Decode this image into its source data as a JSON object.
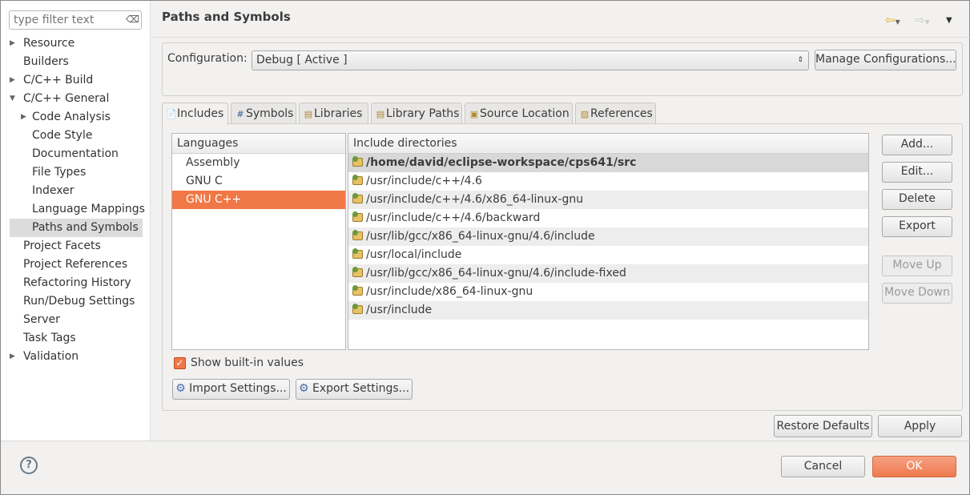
{
  "sidebar": {
    "filter_placeholder": "type filter text",
    "items": [
      {
        "label": "Resource",
        "level": 0,
        "arrow": "collapsed"
      },
      {
        "label": "Builders",
        "level": 0,
        "arrow": "none"
      },
      {
        "label": "C/C++ Build",
        "level": 0,
        "arrow": "collapsed"
      },
      {
        "label": "C/C++ General",
        "level": 0,
        "arrow": "expanded"
      },
      {
        "label": "Code Analysis",
        "level": 1,
        "arrow": "collapsed"
      },
      {
        "label": "Code Style",
        "level": 1,
        "arrow": "none"
      },
      {
        "label": "Documentation",
        "level": 1,
        "arrow": "none"
      },
      {
        "label": "File Types",
        "level": 1,
        "arrow": "none"
      },
      {
        "label": "Indexer",
        "level": 1,
        "arrow": "none"
      },
      {
        "label": "Language Mappings",
        "level": 1,
        "arrow": "none"
      },
      {
        "label": "Paths and Symbols",
        "level": 1,
        "arrow": "none",
        "selected": true
      },
      {
        "label": "Project Facets",
        "level": 0,
        "arrow": "none"
      },
      {
        "label": "Project References",
        "level": 0,
        "arrow": "none"
      },
      {
        "label": "Refactoring History",
        "level": 0,
        "arrow": "none"
      },
      {
        "label": "Run/Debug Settings",
        "level": 0,
        "arrow": "none"
      },
      {
        "label": "Server",
        "level": 0,
        "arrow": "none"
      },
      {
        "label": "Task Tags",
        "level": 0,
        "arrow": "none"
      },
      {
        "label": "Validation",
        "level": 0,
        "arrow": "collapsed"
      }
    ]
  },
  "header": {
    "title": "Paths and Symbols"
  },
  "config": {
    "label": "Configuration:",
    "value": "Debug  [ Active ]",
    "manage": "Manage Configurations..."
  },
  "tabs": [
    {
      "label": "Includes",
      "icon": "includes-icon"
    },
    {
      "label": "Symbols",
      "icon": "hash-icon"
    },
    {
      "label": "Libraries",
      "icon": "libraries-icon"
    },
    {
      "label": "Library Paths",
      "icon": "library-paths-icon"
    },
    {
      "label": "Source Location",
      "icon": "source-folder-icon"
    },
    {
      "label": "References",
      "icon": "references-icon"
    }
  ],
  "languages": {
    "header": "Languages",
    "items": [
      "Assembly",
      "GNU C",
      "GNU C++"
    ],
    "selected": "GNU C++"
  },
  "includes": {
    "header": "Include directories",
    "items": [
      "/home/david/eclipse-workspace/cps641/src",
      "/usr/include/c++/4.6",
      "/usr/include/c++/4.6/x86_64-linux-gnu",
      "/usr/include/c++/4.6/backward",
      "/usr/lib/gcc/x86_64-linux-gnu/4.6/include",
      "/usr/local/include",
      "/usr/lib/gcc/x86_64-linux-gnu/4.6/include-fixed",
      "/usr/include/x86_64-linux-gnu",
      "/usr/include"
    ]
  },
  "side_buttons": [
    "Add...",
    "Edit...",
    "Delete",
    "Export",
    "Move Up",
    "Move Down"
  ],
  "show_builtin": {
    "label": "Show built-in values",
    "checked": true
  },
  "import_label": "Import Settings...",
  "export_label": "Export Settings...",
  "restore_label": "Restore Defaults",
  "apply_label": "Apply",
  "cancel_label": "Cancel",
  "ok_label": "OK",
  "colors": {
    "accent": "#f07746"
  }
}
